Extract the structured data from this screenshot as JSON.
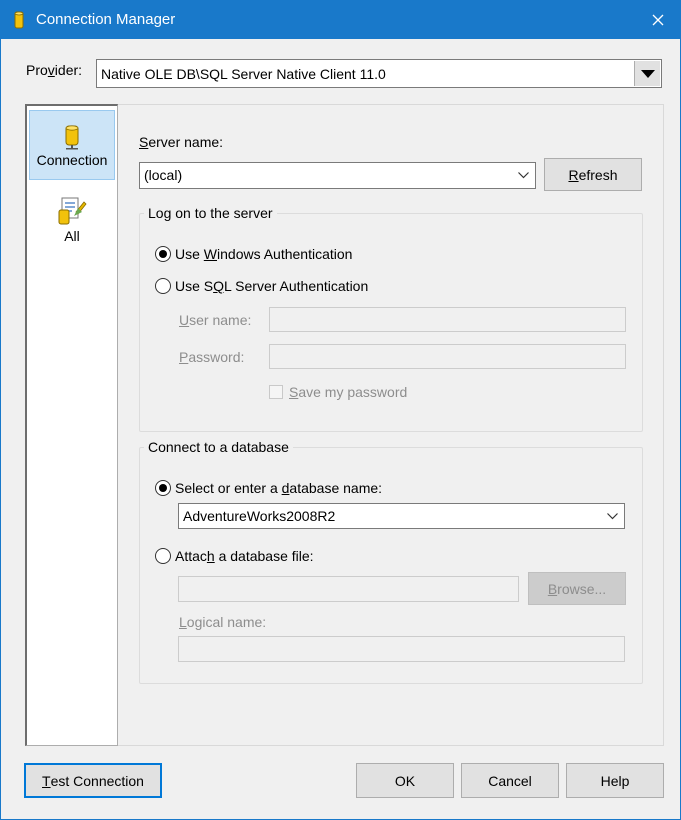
{
  "window": {
    "title": "Connection Manager",
    "accent_color": "#1979ca"
  },
  "provider": {
    "label_pre": "Pro",
    "label_key": "v",
    "label_post": "ider:",
    "value": "Native OLE DB\\SQL Server Native Client 11.0"
  },
  "nav": {
    "items": [
      {
        "label": "Connection",
        "icon": "database-icon",
        "selected": true
      },
      {
        "label": "All",
        "icon": "properties-icon",
        "selected": false
      }
    ]
  },
  "server": {
    "label_key": "S",
    "label_post": "erver name:",
    "value": "(local)",
    "refresh_key": "R",
    "refresh_post": "efresh"
  },
  "logon": {
    "group_title": "Log on to the server",
    "windows_auth_pre": "Use ",
    "windows_auth_key": "W",
    "windows_auth_post": "indows Authentication",
    "sql_auth_pre": "Use S",
    "sql_auth_key": "Q",
    "sql_auth_post": "L Server Authentication",
    "username_key": "U",
    "username_post": "ser name:",
    "password_key": "P",
    "password_post": "assword:",
    "save_password_key": "S",
    "save_password_post": "ave my password"
  },
  "database": {
    "group_title": "Connect to a database",
    "select_pre": "Select or enter a ",
    "select_key": "d",
    "select_post": "atabase name:",
    "database_value": "AdventureWorks2008R2",
    "attach_pre": "Attac",
    "attach_key": "h",
    "attach_post": " a database file:",
    "browse_key": "B",
    "browse_post": "rowse...",
    "logical_key": "L",
    "logical_post": "ogical name:"
  },
  "buttons": {
    "test_key": "T",
    "test_post": "est Connection",
    "ok": "OK",
    "cancel": "Cancel",
    "help": "Help"
  }
}
